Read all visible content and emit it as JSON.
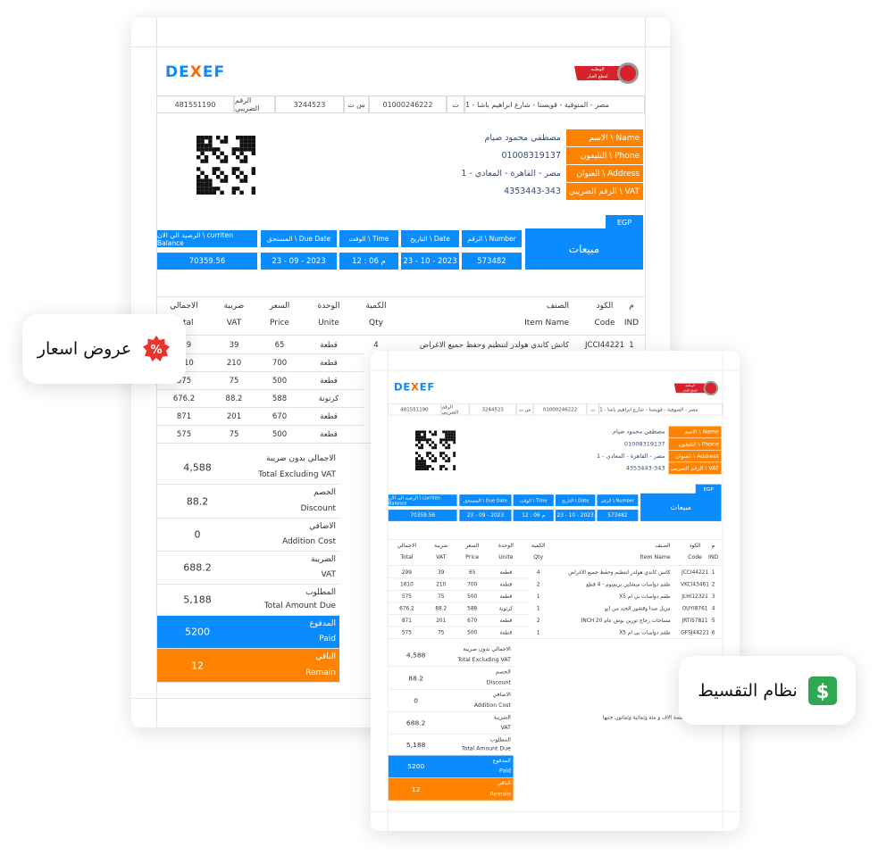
{
  "logo_text": "DEXEF",
  "partner_logo_text": "الوطنية لقطع الغيار",
  "info_row": {
    "address": "مصر - المنوفية - قويسنا - شارع ابراهيم باشا - 1",
    "phone_label": "ت",
    "phone": "01000246222",
    "cr_label": "س ت",
    "cr": "3244523",
    "tax_label": "الرقم الضريبي",
    "tax": "481551190"
  },
  "customer": [
    {
      "label": "الاسم \\ Name",
      "value": "مصطفي محمود صيام"
    },
    {
      "label": "التليفون \\ Phone",
      "value": "01008319137"
    },
    {
      "label": "العنوان \\ Address",
      "value": "مصر - القاهرة - المعادي - 1"
    },
    {
      "label": "الرقم الضريبي \\ VAT",
      "value": "4353443-343"
    }
  ],
  "currency": "EGP",
  "doc_type": "مبيعات",
  "meta": [
    {
      "label": "الرقم \\ Number",
      "value": "573482"
    },
    {
      "label": "التاريخ \\ Date",
      "value": "23 - 10 - 2023"
    },
    {
      "label": "الوقت \\ Time",
      "value": "12 : 06  م"
    },
    {
      "label": "المستحق \\ Due Date",
      "value": "23 - 09 - 2023"
    },
    {
      "label": "الرصيد الي الان \\ curriten Balance",
      "value": "70359.56"
    }
  ],
  "table": {
    "headers": [
      {
        "ar": "م",
        "en": "IND"
      },
      {
        "ar": "الكود",
        "en": "Code"
      },
      {
        "ar": "الصنف",
        "en": "Item Name"
      },
      {
        "ar": "الكمية",
        "en": "Qty"
      },
      {
        "ar": "الوحدة",
        "en": "Unite"
      },
      {
        "ar": "السعر",
        "en": "Price"
      },
      {
        "ar": "ضريبة",
        "en": "VAT"
      },
      {
        "ar": "الاجمالي",
        "en": "Total"
      }
    ],
    "rows": [
      [
        "1",
        "JCCI44221",
        "كاتش كاندي هولدر لتنظيم وحفظ جميع الاغراض",
        "4",
        "قطعة",
        "65",
        "39",
        "299"
      ],
      [
        "2",
        "VKCI43461",
        "طقم دواسات ميشلين بريميوم - 4 قطع",
        "2",
        "قطعة",
        "700",
        "210",
        "1610"
      ],
      [
        "3",
        "JLHI12321",
        "طقم دواسات بي ام X5",
        "1",
        "قطعة",
        "500",
        "75",
        "575"
      ],
      [
        "4",
        "OUYI8761",
        "مزيل صدا وقشور الجبد من ايو",
        "1",
        "كرتونة",
        "588",
        "88.2",
        "676.2"
      ],
      [
        "5",
        "JRTI57821",
        "مساحات زجاج تورين بوش عام 20 INCH",
        "2",
        "قطعة",
        "670",
        "201",
        "871"
      ],
      [
        "6",
        "GFSJ44221",
        "طقم دواسات بي ام X5",
        "1",
        "قطعة",
        "500",
        "75",
        "575"
      ]
    ]
  },
  "totals": [
    {
      "ar": "الاجمالي بدون ضريبة",
      "en": "Total Excluding VAT",
      "value": "4,588"
    },
    {
      "ar": "الخصم",
      "en": "Discount",
      "value": "88.2"
    },
    {
      "ar": "الاضافي",
      "en": "Addition Cost",
      "value": "0"
    },
    {
      "ar": "الضريبة",
      "en": "VAT",
      "value": "688.2"
    },
    {
      "ar": "المطلوب",
      "en": "Total Amount Due",
      "value": "5,188"
    },
    {
      "ar": "المدفوع",
      "en": "Paid",
      "value": "5200"
    },
    {
      "ar": "الباقي",
      "en": "Remain",
      "value": "12"
    }
  ],
  "amount_in_words": "جي خمسة الاف و مئة وثمانية وثمانون جنيها",
  "badges": {
    "quotes": {
      "label": "عروض اسعار",
      "icon": "percent-badge-icon",
      "color": "#e8352b"
    },
    "installments": {
      "label": "نظام التقسيط",
      "icon": "dollar-icon",
      "color": "#2fa84f"
    }
  },
  "colors": {
    "brand_blue": "#0a8cff",
    "brand_orange": "#ff8200"
  }
}
